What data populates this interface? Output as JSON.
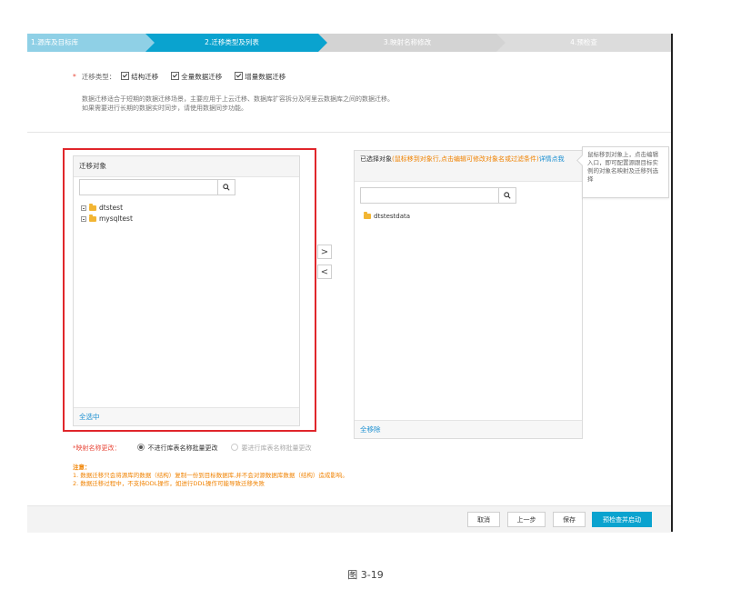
{
  "steps": [
    {
      "label": "1.源库及目标库"
    },
    {
      "label": "2.迁移类型及列表"
    },
    {
      "label": "3.映射名称修改"
    },
    {
      "label": "4.预检查"
    }
  ],
  "migration_type": {
    "required_mark": "*",
    "label": "迁移类型：",
    "options": [
      "结构迁移",
      "全量数据迁移",
      "增量数据迁移"
    ]
  },
  "description": {
    "line1": "数据迁移适合于短期的数据迁移场景，主要应用于上云迁移、数据库扩容拆分及阿里云数据库之间的数据迁移。",
    "line2": "如果需要进行长期的数据实时同步，请使用数据同步功能。"
  },
  "left_panel": {
    "title": "迁移对象",
    "search_placeholder": "",
    "items": [
      "dtstest",
      "mysqltest"
    ],
    "footer": "全选中"
  },
  "right_panel": {
    "title": "已选择对象",
    "hint": "(鼠标移到对象行,点击编辑可修改对象名或过滤条件)",
    "detail_link": "详情点我",
    "items": [
      "dtstestdata"
    ],
    "footer": "全移除"
  },
  "move_buttons": {
    "right": ">",
    "left": "<"
  },
  "tooltip": {
    "text": "鼠标移到对象上，点击编辑入口，即可配置源跟目标实例的对象名映射及迁移列选择"
  },
  "mapping": {
    "label": "*映射名称更改：",
    "option_on": "不进行库表名称批量更改",
    "option_off": "要进行库表名称批量更改"
  },
  "notes": {
    "title": "注意：",
    "line1": "1. 数据迁移只会将源库的数据（结构）复制一份到目标数据库,并不会对源数据库数据（结构）造成影响。",
    "line2": "2. 数据迁移过程中，不支持DDL操作，如进行DDL操作可能导致迁移失败"
  },
  "buttons": {
    "cancel": "取消",
    "prev": "上一步",
    "save": "保存",
    "precheck": "预检查并启动"
  },
  "caption": "图 3-19",
  "colors": {
    "active_step": "#0aa3cf",
    "done_step": "#8fd0e6",
    "pending_step": "#d3d3d3",
    "highlight_box": "#e0262b",
    "note_text": "#f08200",
    "link": "#1a8fd1"
  }
}
